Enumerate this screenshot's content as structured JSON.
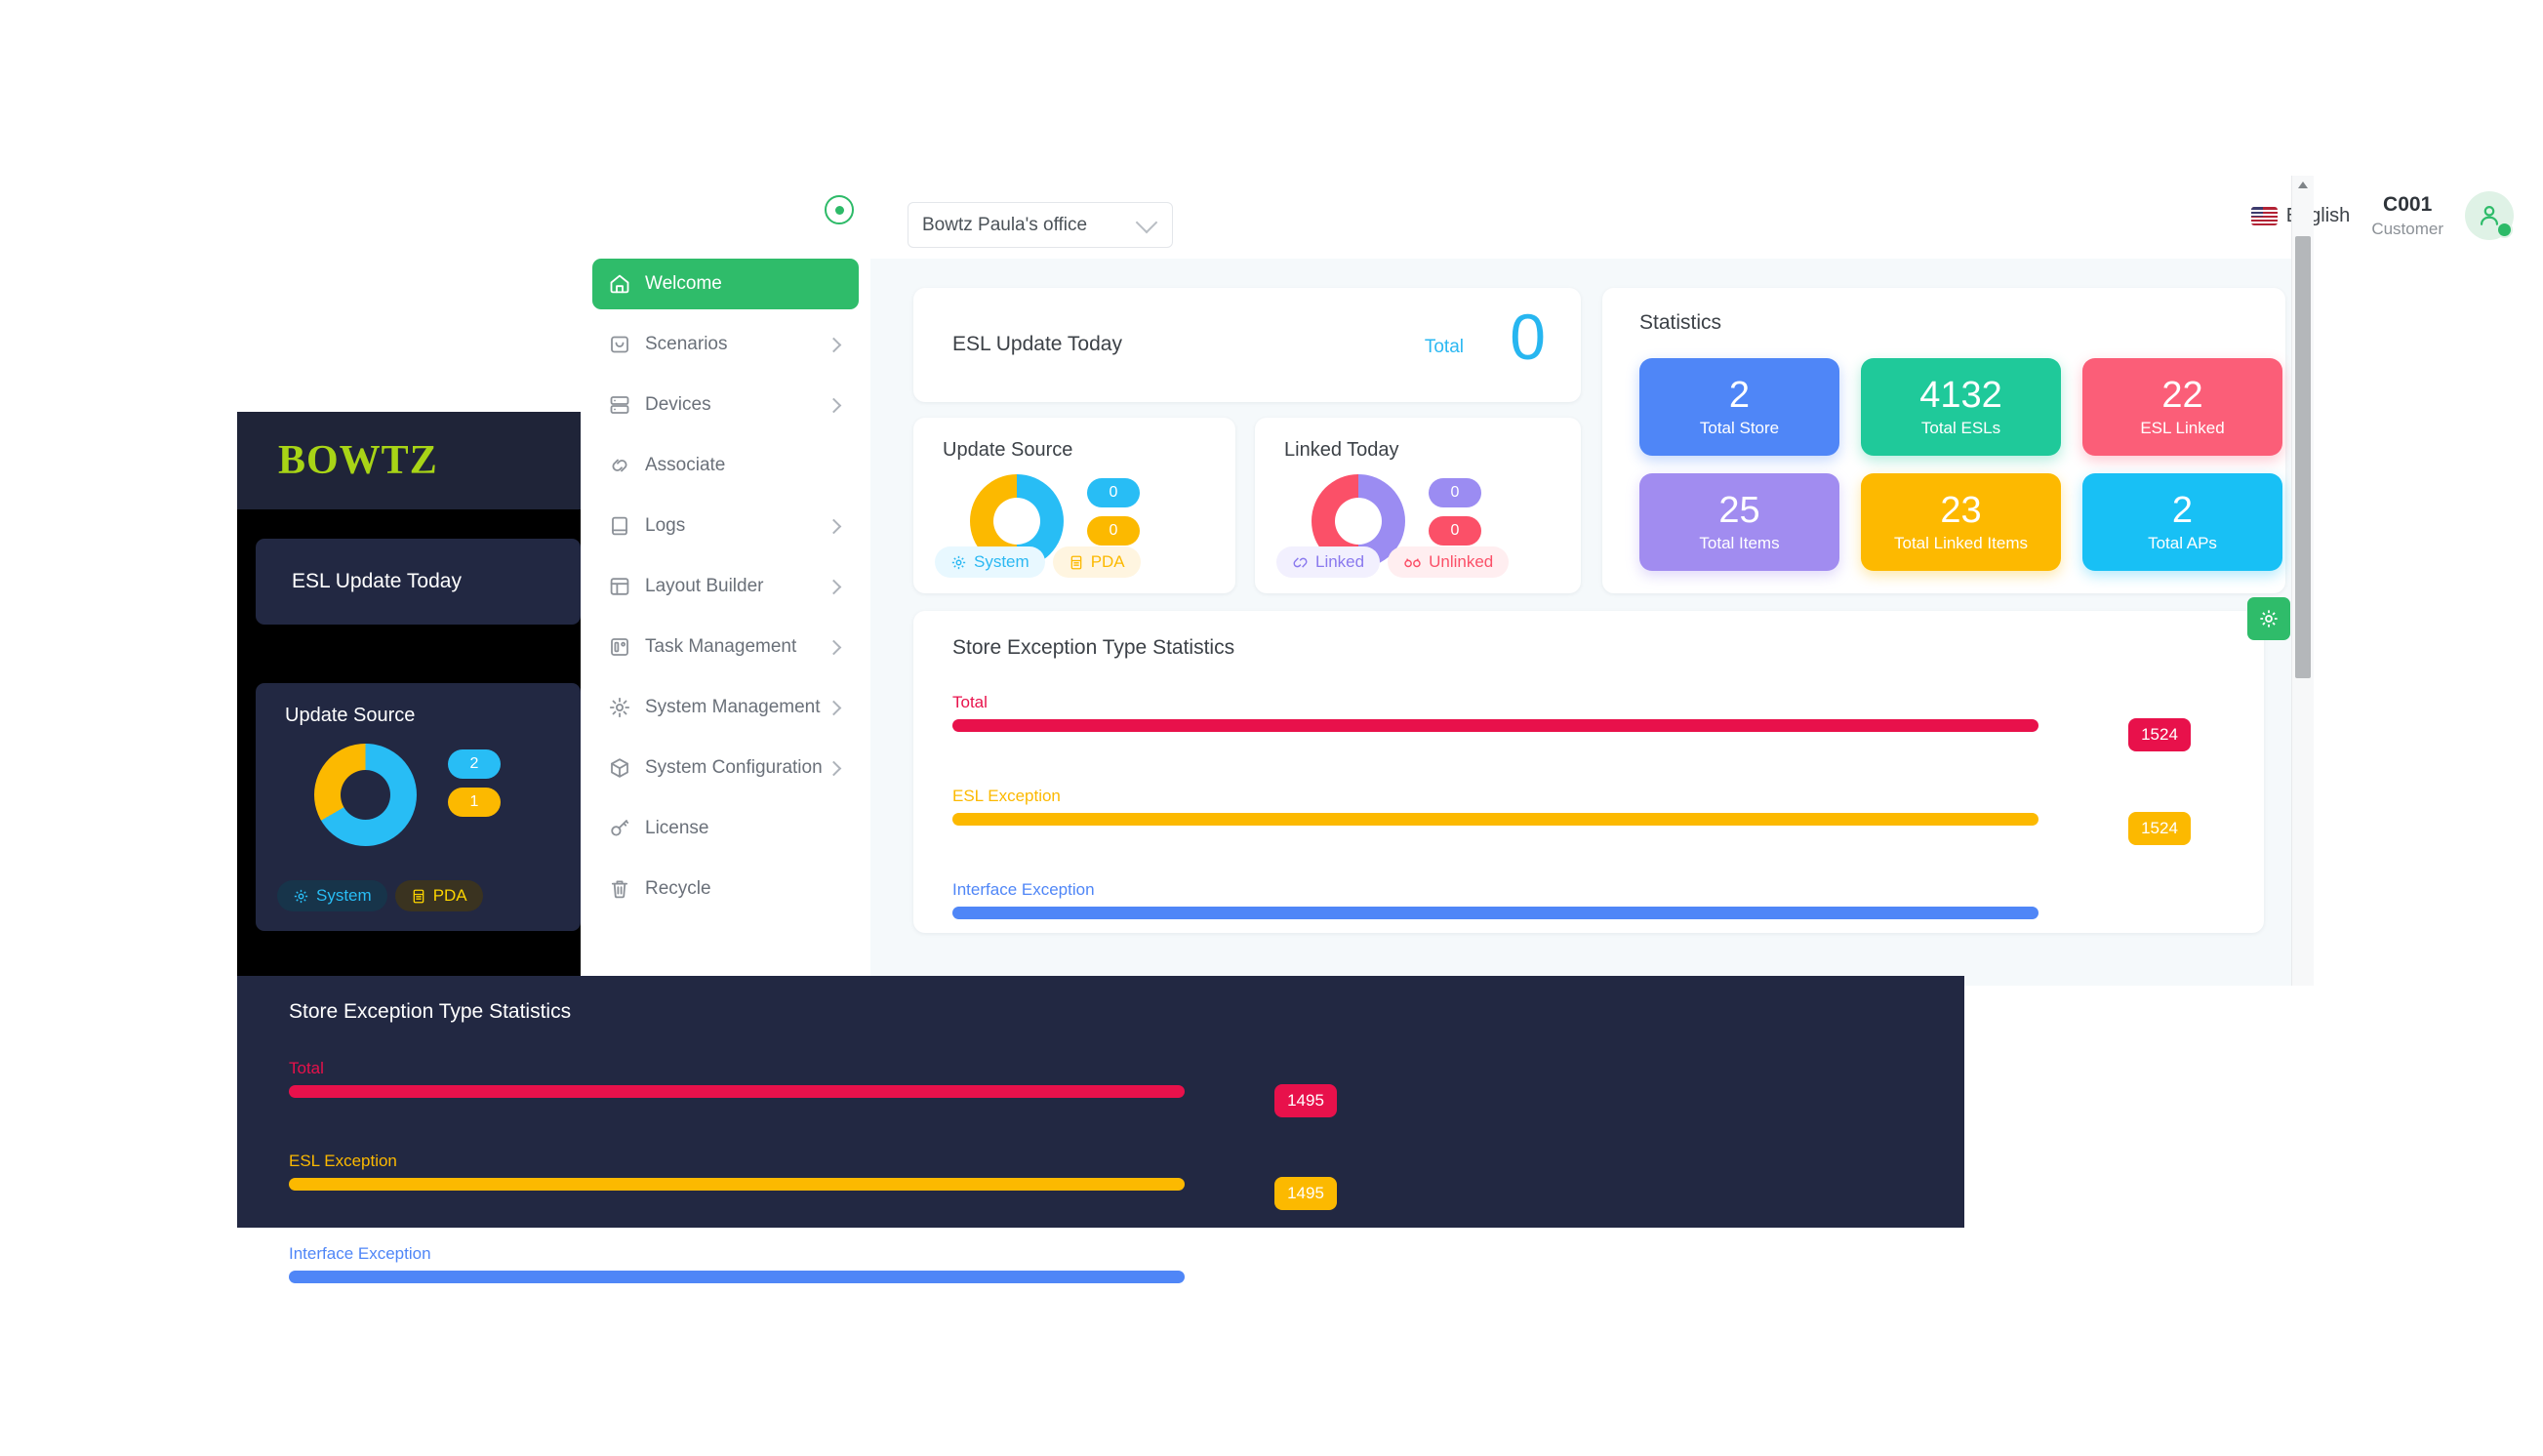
{
  "header": {
    "store_select_value": "Bowtz Paula's office",
    "language": "English",
    "customer_code": "C001",
    "customer_role": "Customer"
  },
  "sidebar": {
    "items": [
      {
        "label": "Welcome",
        "icon": "home-icon",
        "active": true,
        "arrow": false
      },
      {
        "label": "Scenarios",
        "icon": "bag-icon",
        "active": false,
        "arrow": true
      },
      {
        "label": "Devices",
        "icon": "server-icon",
        "active": false,
        "arrow": true
      },
      {
        "label": "Associate",
        "icon": "link-icon",
        "active": false,
        "arrow": false
      },
      {
        "label": "Logs",
        "icon": "book-icon",
        "active": false,
        "arrow": true
      },
      {
        "label": "Layout Builder",
        "icon": "layout-icon",
        "active": false,
        "arrow": true
      },
      {
        "label": "Task Management",
        "icon": "kanban-icon",
        "active": false,
        "arrow": true
      },
      {
        "label": "System Management",
        "icon": "gear-icon",
        "active": false,
        "arrow": true
      },
      {
        "label": "System Configuration",
        "icon": "cube-icon",
        "active": false,
        "arrow": true
      },
      {
        "label": "License",
        "icon": "key-icon",
        "active": false,
        "arrow": false
      },
      {
        "label": "Recycle",
        "icon": "trash-icon",
        "active": false,
        "arrow": false
      }
    ]
  },
  "esl_update": {
    "title": "ESL Update Today",
    "total_label": "Total",
    "total_value": "0"
  },
  "update_source": {
    "title": "Update Source",
    "system_value": "0",
    "pda_value": "0",
    "legend_system": "System",
    "legend_pda": "PDA"
  },
  "linked_today": {
    "title": "Linked Today",
    "linked_value": "0",
    "unlinked_value": "0",
    "legend_linked": "Linked",
    "legend_unlinked": "Unlinked"
  },
  "statistics": {
    "title": "Statistics",
    "tiles": [
      {
        "value": "2",
        "caption": "Total Store",
        "color": "#4f86f7"
      },
      {
        "value": "4132",
        "caption": "Total ESLs",
        "color": "#1fc99a"
      },
      {
        "value": "22",
        "caption": "ESL Linked",
        "color": "#fb5e78"
      },
      {
        "value": "25",
        "caption": "Total Items",
        "color": "#a18cf0"
      },
      {
        "value": "23",
        "caption": "Total Linked Items",
        "color": "#fdb900"
      },
      {
        "value": "2",
        "caption": "Total APs",
        "color": "#18c0f5"
      }
    ]
  },
  "store_exception": {
    "title": "Store Exception Type Statistics",
    "rows": [
      {
        "label": "Total",
        "value": "1524",
        "color": "#e8114b",
        "pct": 100
      },
      {
        "label": "ESL Exception",
        "value": "1524",
        "color": "#fcb900",
        "pct": 100
      },
      {
        "label": "Interface Exception",
        "value": "",
        "color": "#4f86f7",
        "pct": 100
      }
    ]
  },
  "dark_panel": {
    "brand": "BOWTZ",
    "esl_title": "ESL Update Today",
    "update_source": {
      "title": "Update Source",
      "system_value": "2",
      "pda_value": "1",
      "legend_system": "System",
      "legend_pda": "PDA"
    },
    "store_exception": {
      "title": "Store Exception Type Statistics",
      "rows": [
        {
          "label": "Total",
          "value": "1495",
          "color": "#e8114b",
          "pct": 100
        },
        {
          "label": "ESL Exception",
          "value": "1495",
          "color": "#fcb900",
          "pct": 100
        },
        {
          "label": "Interface Exception",
          "value": "",
          "color": "#4f86f7",
          "pct": 100
        }
      ]
    }
  },
  "chart_data": [
    {
      "type": "pie",
      "title": "Update Source",
      "categories": [
        "System",
        "PDA"
      ],
      "values": [
        0,
        0
      ],
      "colors": [
        "#28bdf5",
        "#fcb900"
      ],
      "legend": "bottom"
    },
    {
      "type": "pie",
      "title": "Linked Today",
      "categories": [
        "Linked",
        "Unlinked"
      ],
      "values": [
        0,
        0
      ],
      "colors": [
        "#9b8cf2",
        "#fb5068"
      ],
      "legend": "bottom"
    },
    {
      "type": "bar",
      "title": "Store Exception Type Statistics",
      "categories": [
        "Total",
        "ESL Exception",
        "Interface Exception"
      ],
      "values": [
        1524,
        1524,
        null
      ],
      "colors": [
        "#e8114b",
        "#fcb900",
        "#4f86f7"
      ],
      "orientation": "horizontal"
    },
    {
      "type": "bar",
      "title": "Store Exception Type Statistics",
      "categories": [
        "Total",
        "ESL Exception",
        "Interface Exception"
      ],
      "values": [
        1495,
        1495,
        null
      ],
      "colors": [
        "#e8114b",
        "#fcb900",
        "#4f86f7"
      ],
      "orientation": "horizontal"
    },
    {
      "type": "bar",
      "title": "Statistics",
      "categories": [
        "Total Store",
        "Total ESLs",
        "ESL Linked",
        "Total Items",
        "Total Linked Items",
        "Total APs"
      ],
      "values": [
        2,
        4132,
        22,
        25,
        23,
        2
      ]
    }
  ]
}
